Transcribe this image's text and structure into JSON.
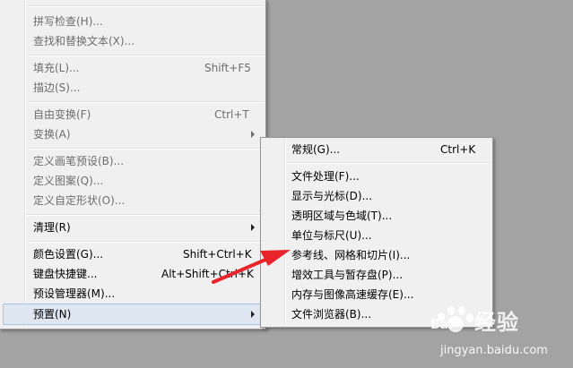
{
  "main_menu": {
    "items": [
      {
        "label": "拼写检查(H)...",
        "shortcut": "",
        "enabled": false
      },
      {
        "label": "查找和替换文本(X)...",
        "shortcut": "",
        "enabled": false
      },
      {
        "label": "填充(L)...",
        "shortcut": "Shift+F5",
        "enabled": false
      },
      {
        "label": "描边(S)...",
        "shortcut": "",
        "enabled": false
      },
      {
        "label": "自由变换(F)",
        "shortcut": "Ctrl+T",
        "enabled": false
      },
      {
        "label": "变换(A)",
        "shortcut": "",
        "enabled": false
      },
      {
        "label": "定义画笔预设(B)...",
        "shortcut": "",
        "enabled": false
      },
      {
        "label": "定义图案(Q)...",
        "shortcut": "",
        "enabled": false
      },
      {
        "label": "定义自定形状(O)...",
        "shortcut": "",
        "enabled": false
      },
      {
        "label": "清理(R)",
        "shortcut": "",
        "enabled": true
      },
      {
        "label": "颜色设置(G)...",
        "shortcut": "Shift+Ctrl+K",
        "enabled": true
      },
      {
        "label": "键盘快捷键...",
        "shortcut": "Alt+Shift+Ctrl+K",
        "enabled": true
      },
      {
        "label": "预设管理器(M)...",
        "shortcut": "",
        "enabled": true
      },
      {
        "label": "预置(N)",
        "shortcut": "",
        "enabled": true
      }
    ]
  },
  "sub_menu": {
    "items": [
      {
        "label": "常规(G)...",
        "shortcut": "Ctrl+K"
      },
      {
        "label": "文件处理(F)...",
        "shortcut": ""
      },
      {
        "label": "显示与光标(D)...",
        "shortcut": ""
      },
      {
        "label": "透明区域与色域(T)...",
        "shortcut": ""
      },
      {
        "label": "单位与标尺(U)...",
        "shortcut": ""
      },
      {
        "label": "参考线、网格和切片(I)...",
        "shortcut": ""
      },
      {
        "label": "增效工具与暂存盘(P)...",
        "shortcut": ""
      },
      {
        "label": "内存与图像高速缓存(E)...",
        "shortcut": ""
      },
      {
        "label": "文件浏览器(B)...",
        "shortcut": ""
      }
    ]
  },
  "watermark": {
    "brand": "经验",
    "url": "jingyan.baidu.com"
  },
  "colors": {
    "background": "#a3a3a3",
    "menu_bg": "#f0f0f0",
    "highlight": "#dde6f1",
    "arrow_red": "#e8242a"
  }
}
